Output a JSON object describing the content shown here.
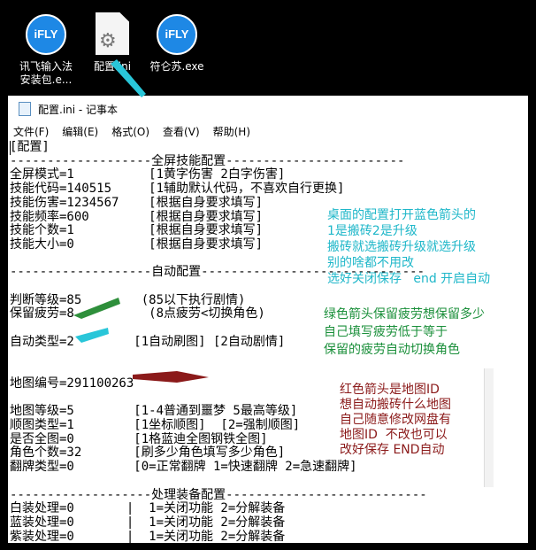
{
  "desktop": {
    "icons": [
      {
        "label": "讯飞输入法\n安装包.e...",
        "badge": "iFLY"
      },
      {
        "label": "配置.ini"
      },
      {
        "label": "符仑苏.exe",
        "badge": "iFLY"
      }
    ]
  },
  "window": {
    "title": "配置.ini - 记事本",
    "menu": [
      "文件(F)",
      "编辑(E)",
      "格式(O)",
      "查看(V)",
      "帮助(H)"
    ]
  },
  "editor": {
    "lines": [
      "[配置]",
      "-------------------全屏技能配置------------------------",
      "全屏模式=1          [1黄字伤害 2白字伤害]",
      "技能代码=140515     [1辅助默认代码，不喜欢自行更换]",
      "技能伤害=1234567    [根据自身要求填写]",
      "技能频率=600        [根据自身要求填写]",
      "技能个数=1          [根据自身要求填写]",
      "技能大小=0          [根据自身要求填写]",
      "",
      "-------------------自动配置------------------------------",
      "",
      "判断等级=85        (85以下执行剧情)",
      "保留疲劳=8          (8点疲劳<切换角色)",
      "",
      "自动类型=2        [1自动刷图] [2自动剧情]",
      "",
      "",
      "地图编号=291100263",
      "",
      "地图等级=5        [1-4普通到噩梦 5最高等级]",
      "顺图类型=1        [1坐标顺图]  [2=强制顺图]",
      "是否全图=0        [1格蓝迪全图钢铁全图]",
      "角色个数=32       [刷多少角色填写多少角色]",
      "翻牌类型=0        [0=正常翻牌 1=快速翻牌 2=急速翻牌]",
      "",
      "-------------------处理装备配置---------------------------",
      "白装处理=0       |  1=关闭功能 2=分解装备",
      "蓝装处理=0       |  1=关闭功能 2=分解装备",
      "紫装处理=0       |  1=关闭功能 2=分解装备"
    ]
  },
  "notes": {
    "cyan": "桌面的配置打开蓝色箭头的\n1是搬砖2是升级\n搬砖就选搬砖升级就选升级\n别的啥都不用改\n选好关闭保存   end 开启自动",
    "green": "绿色箭头保留疲劳想保留多少\n自己填写疲劳低于等于\n保留的疲劳自动切换角色",
    "red": "红色箭头是地图ID\n想自动搬砖什么地图\n自己随意修改网盘有\n地图ID  不改也可以\n改好保存 END自动"
  },
  "colors": {
    "cyan": "#1fb7c9",
    "green": "#1a8f3a",
    "red": "#8b1a1a"
  }
}
